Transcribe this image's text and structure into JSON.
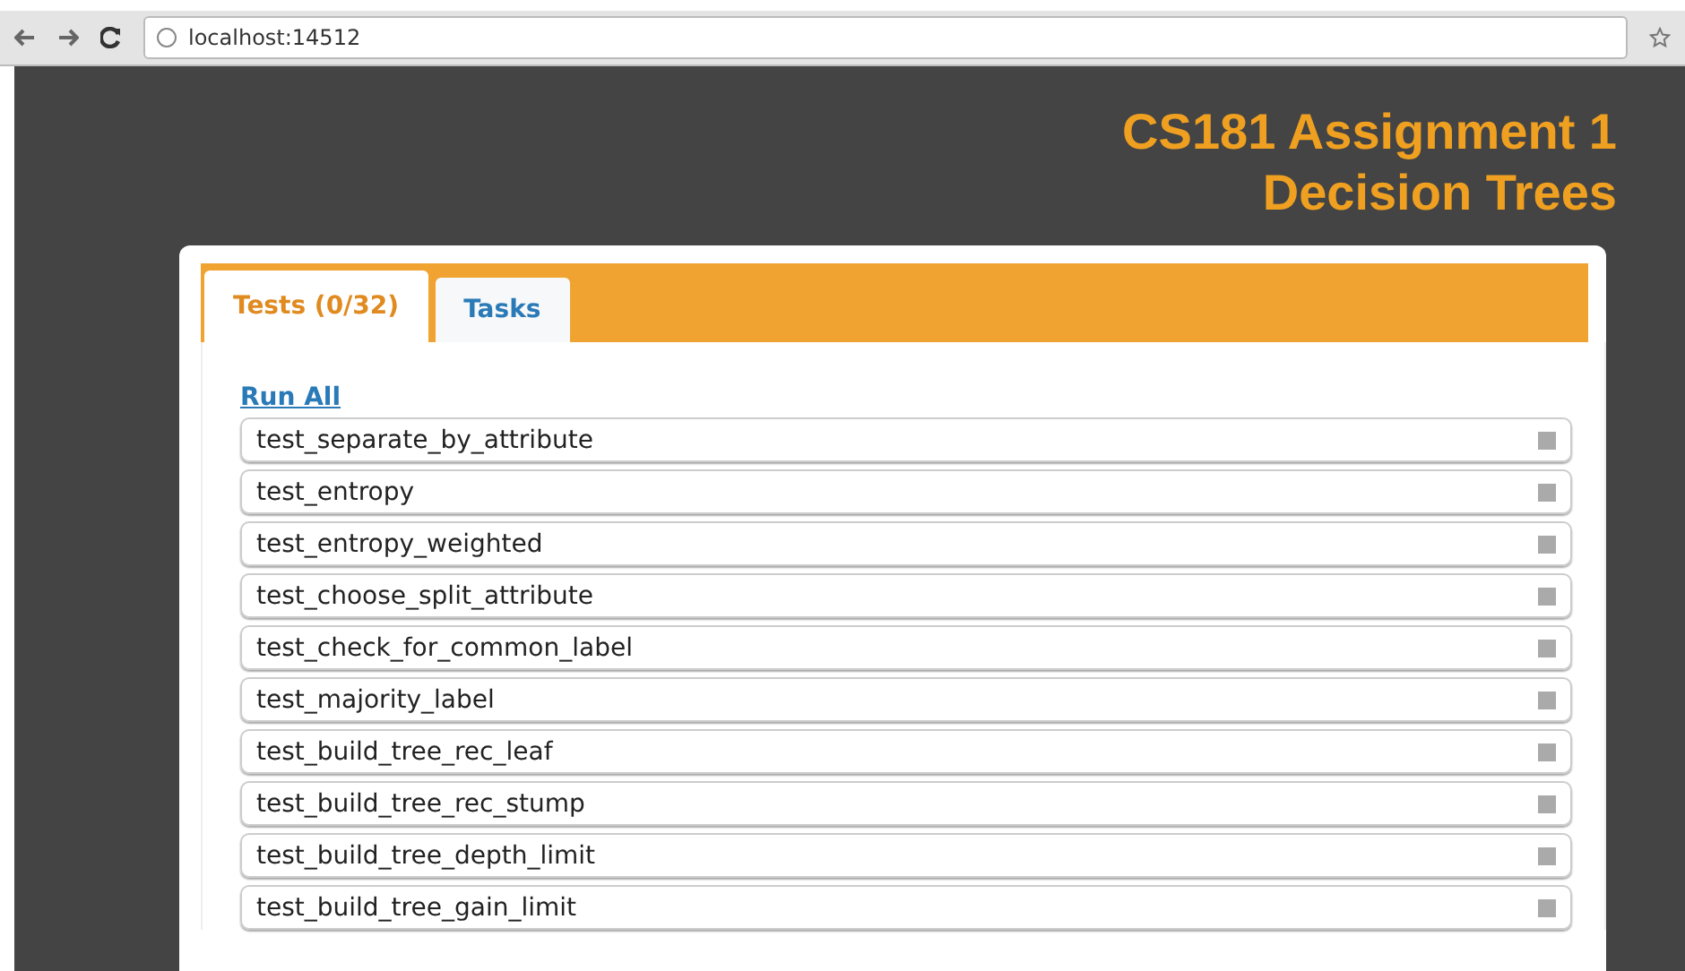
{
  "browser": {
    "url": "localhost:14512"
  },
  "header": {
    "title_lines": [
      "CS181 Assignment 1",
      "Decision Trees"
    ]
  },
  "tabs": [
    {
      "label": "Tests (0/32)",
      "selected": true
    },
    {
      "label": "Tasks",
      "selected": false
    }
  ],
  "run_all": "Run All",
  "tests": [
    {
      "name": "test_separate_by_attribute"
    },
    {
      "name": "test_entropy"
    },
    {
      "name": "test_entropy_weighted"
    },
    {
      "name": "test_choose_split_attribute"
    },
    {
      "name": "test_check_for_common_label"
    },
    {
      "name": "test_majority_label"
    },
    {
      "name": "test_build_tree_rec_leaf"
    },
    {
      "name": "test_build_tree_rec_stump"
    },
    {
      "name": "test_build_tree_depth_limit"
    },
    {
      "name": "test_build_tree_gain_limit"
    }
  ]
}
